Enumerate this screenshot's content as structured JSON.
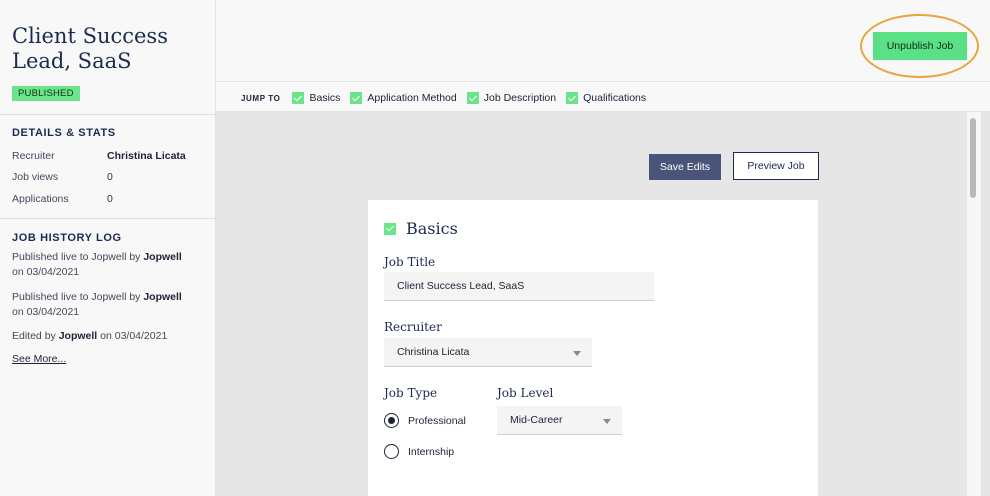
{
  "job": {
    "title": "Client Success Lead, SaaS",
    "status_badge": "PUBLISHED"
  },
  "details": {
    "heading": "DETAILS & STATS",
    "stats": [
      {
        "label": "Recruiter",
        "value": "Christina Licata"
      },
      {
        "label": "Job views",
        "value": "0"
      },
      {
        "label": "Applications",
        "value": "0"
      }
    ]
  },
  "history": {
    "heading": "JOB HISTORY LOG",
    "entries": [
      {
        "before": "Published live to Jopwell by ",
        "bold": "Jopwell",
        "after": "on 03/04/2021"
      },
      {
        "before": "Published live to Jopwell by ",
        "bold": "Jopwell",
        "after": "on 03/04/2021"
      },
      {
        "before": "Edited by ",
        "bold": "Jopwell",
        "after": " on 03/04/2021"
      }
    ],
    "see_more": "See More..."
  },
  "toolbar": {
    "unpublish_label": "Unpublish Job",
    "jump_to_label": "JUMP TO",
    "jump_items": [
      "Basics",
      "Application Method",
      "Job Description",
      "Qualifications"
    ],
    "save_label": "Save Edits",
    "preview_label": "Preview Job"
  },
  "form": {
    "section_title": "Basics",
    "job_title_label": "Job Title",
    "job_title_value": "Client Success Lead, SaaS",
    "recruiter_label": "Recruiter",
    "recruiter_value": "Christina Licata",
    "job_type_label": "Job Type",
    "job_type_options": [
      "Professional",
      "Internship"
    ],
    "job_type_selected": "Professional",
    "job_level_label": "Job Level",
    "job_level_value": "Mid-Career"
  },
  "colors": {
    "accent_green": "#5be185",
    "navy": "#1b2a4e",
    "button_navy": "#4a5378",
    "highlight_orange": "#e9a53c"
  }
}
